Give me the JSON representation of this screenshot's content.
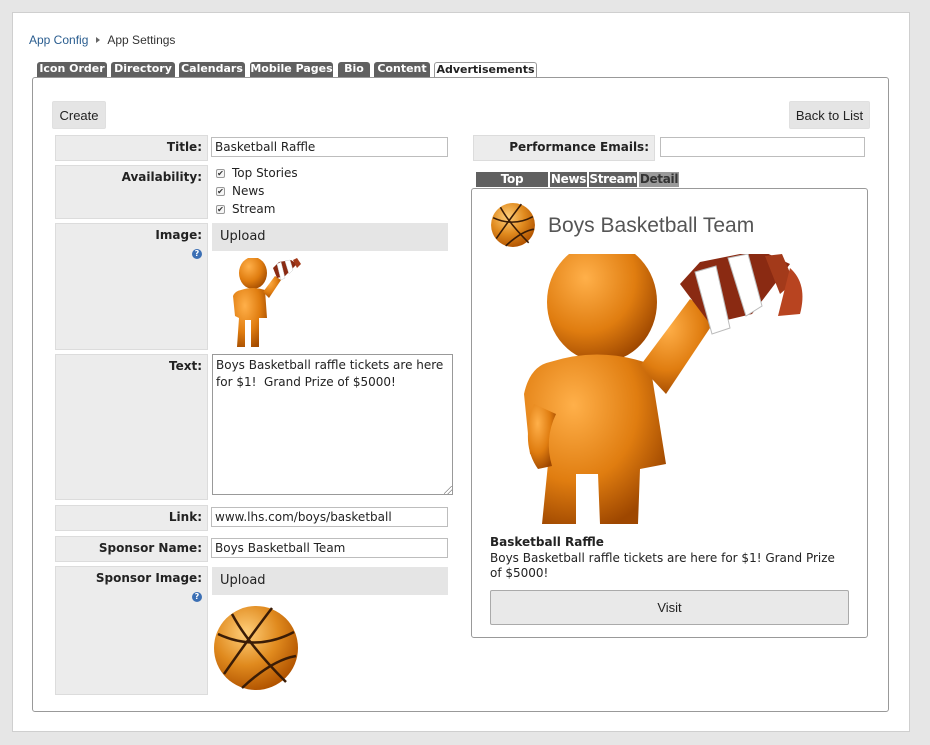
{
  "breadcrumb": {
    "link": "App Config",
    "current": "App Settings"
  },
  "tabs": [
    "Icon Order",
    "Directory",
    "Calendars",
    "Mobile Pages",
    "Bio",
    "Content",
    "Advertisements"
  ],
  "active_tab": "Advertisements",
  "toolbar": {
    "create_label": "Create",
    "back_label": "Back to List"
  },
  "form": {
    "title_label": "Title:",
    "title_value": "Basketball Raffle",
    "availability_label": "Availability:",
    "availability_options": [
      {
        "label": "Top Stories",
        "checked": true
      },
      {
        "label": "News",
        "checked": true
      },
      {
        "label": "Stream",
        "checked": true
      }
    ],
    "image_label": "Image:",
    "upload_label": "Upload",
    "text_label": "Text:",
    "text_value": "Boys Basketball raffle tickets are here for $1!  Grand Prize of $5000!",
    "link_label": "Link:",
    "link_value": "www.lhs.com/boys/basketball",
    "sponsor_name_label": "Sponsor Name:",
    "sponsor_name_value": "Boys Basketball Team",
    "sponsor_image_label": "Sponsor Image:",
    "sponsor_upload_label": "Upload",
    "performance_emails_label": "Performance Emails:",
    "performance_emails_value": "",
    "help_glyph": "?"
  },
  "preview": {
    "tabs": [
      "Top Stories",
      "News",
      "Stream",
      "Detail"
    ],
    "active_tab": "Detail",
    "sponsor_name": "Boys Basketball Team",
    "ad_title": "Basketball Raffle",
    "ad_text": "Boys Basketball raffle tickets are here for $1!  Grand Prize of $5000!",
    "visit_label": "Visit"
  },
  "colors": {
    "tab_bg": "#606060",
    "link": "#2a5d8f",
    "ball": "#d9721c",
    "figure": "#e07d10"
  }
}
